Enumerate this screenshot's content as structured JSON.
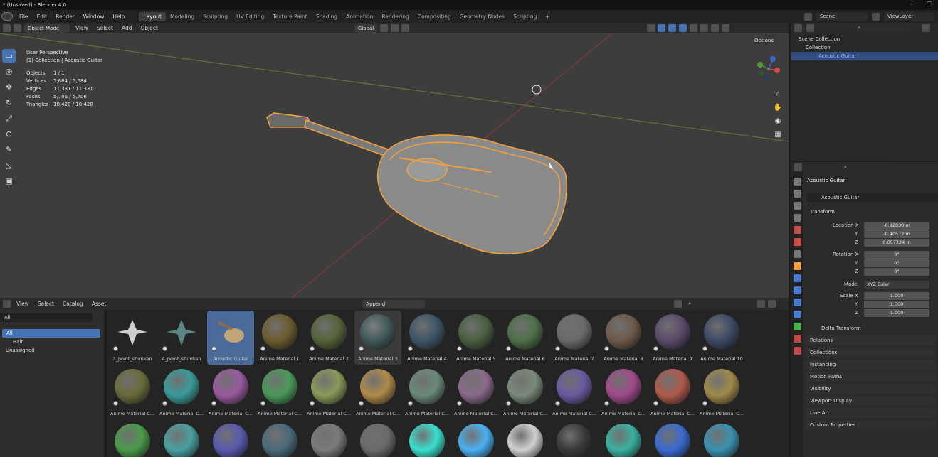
{
  "window": {
    "title": "* (Unsaved) - Blender 4.0"
  },
  "menu": [
    "File",
    "Edit",
    "Render",
    "Window",
    "Help"
  ],
  "workspaces": [
    "Layout",
    "Modeling",
    "Sculpting",
    "UV Editing",
    "Texture Paint",
    "Shading",
    "Animation",
    "Rendering",
    "Compositing",
    "Geometry Nodes",
    "Scripting"
  ],
  "scene": {
    "name": "Scene",
    "view_layer": "ViewLayer"
  },
  "viewport": {
    "mode": "Object Mode",
    "header_menus": [
      "View",
      "Select",
      "Add",
      "Object"
    ],
    "orientation": "Global",
    "options_label": "Options",
    "perspective": "User Perspective",
    "collection_line": "(1) Collection | Acoustic Guitar",
    "stats": [
      {
        "label": "Objects",
        "value": "1 / 1"
      },
      {
        "label": "Vertices",
        "value": "5,684 / 5,684"
      },
      {
        "label": "Edges",
        "value": "11,331 / 11,331"
      },
      {
        "label": "Faces",
        "value": "5,706 / 5,706"
      },
      {
        "label": "Triangles",
        "value": "10,420 / 10,420"
      }
    ],
    "gizmo_axes": [
      "X",
      "Y",
      "Z"
    ]
  },
  "asset_browser": {
    "menus": [
      "View",
      "Select",
      "Catalog",
      "Asset"
    ],
    "import_method": "Append",
    "library": "All",
    "catalogs": [
      {
        "label": "All",
        "selected": true
      },
      {
        "label": "Hair",
        "selected": false
      },
      {
        "label": "Unassigned",
        "selected": false
      }
    ],
    "row1": [
      {
        "label": "3_point_shuriken",
        "color": "#cfcfcf"
      },
      {
        "label": "4_point_shuriken",
        "color": "#5a8686"
      },
      {
        "label": "Acoustic Guitar",
        "color": "#c2a47a"
      },
      {
        "label": "Anime Material 1",
        "color": "#6b5b2e"
      },
      {
        "label": "Anime Material 2",
        "color": "#55633a"
      },
      {
        "label": "Anime Material 3",
        "color": "#3f5a5a"
      },
      {
        "label": "Anime Material 4",
        "color": "#3e5468"
      },
      {
        "label": "Anime Material 5",
        "color": "#4a6040"
      },
      {
        "label": "Anime Material 6",
        "color": "#4f7048"
      },
      {
        "label": "Anime Material 7",
        "color": "#6a6a6a"
      },
      {
        "label": "Anime Material 8",
        "color": "#6e5a4a"
      },
      {
        "label": "Anime Material 9",
        "color": "#5a4a6a"
      },
      {
        "label": "Anime Material 10",
        "color": "#3e4a66"
      }
    ],
    "row2": [
      {
        "label": "Anime Material C...",
        "color": "#6a6a3a"
      },
      {
        "label": "Anime Material C...",
        "color": "#3a9a9a"
      },
      {
        "label": "Anime Material C...",
        "color": "#9a5aa0"
      },
      {
        "label": "Anime Material C...",
        "color": "#4a9a5a"
      },
      {
        "label": "Anime Material C...",
        "color": "#8a9a5a"
      },
      {
        "label": "Anime Material C...",
        "color": "#b08a4a"
      },
      {
        "label": "Anime Material C...",
        "color": "#6a8a7a"
      },
      {
        "label": "Anime Material C...",
        "color": "#8a6a8a"
      },
      {
        "label": "Anime Material C...",
        "color": "#7a8a7a"
      },
      {
        "label": "Anime Material C...",
        "color": "#6a5aa0"
      },
      {
        "label": "Anime Material C...",
        "color": "#a04a8a"
      },
      {
        "label": "Anime Material C...",
        "color": "#b05a4a"
      },
      {
        "label": "Anime Material C...",
        "color": "#a08a4a"
      }
    ],
    "row3": [
      {
        "color": "#4a9a4a"
      },
      {
        "color": "#4aa0a0"
      },
      {
        "color": "#5a5ab0"
      },
      {
        "color": "#4a6a7a"
      },
      {
        "color": "#7a7a7a"
      },
      {
        "color": "#6a6a6a"
      },
      {
        "color": "#3ae0d0"
      },
      {
        "color": "#4ab0f0"
      },
      {
        "color": "#d0d0d0"
      },
      {
        "color": "#3a3a3a"
      },
      {
        "color": "#3ab0a0"
      },
      {
        "color": "#3a6ad0"
      },
      {
        "color": "#3a90b0"
      }
    ]
  },
  "outliner": {
    "scene_collection": "Scene Collection",
    "collection": "Collection",
    "object": "Acoustic Guitar"
  },
  "properties": {
    "object_name": "Acoustic Guitar",
    "data_name": "Acoustic Guitar",
    "transform_label": "Transform",
    "location_label": "Location X",
    "location": [
      "-0.92838 m",
      "-0.40572 m",
      "0.057324 m"
    ],
    "rotation_label": "Rotation X",
    "rotation": [
      "0°",
      "0°",
      "0°"
    ],
    "mode_label": "Mode",
    "mode_value": "XYZ Euler",
    "scale_label": "Scale X",
    "scale": [
      "1.000",
      "1.000",
      "1.000"
    ],
    "axis_y": "Y",
    "axis_z": "Z",
    "delta_transform": "Delta Transform",
    "panels": [
      "Relations",
      "Collections",
      "Instancing",
      "Motion Paths",
      "Visibility",
      "Viewport Display",
      "Line Art",
      "Custom Properties"
    ]
  },
  "colors": {
    "accent": "#4772b3",
    "selection_orange": "#f0a040"
  }
}
